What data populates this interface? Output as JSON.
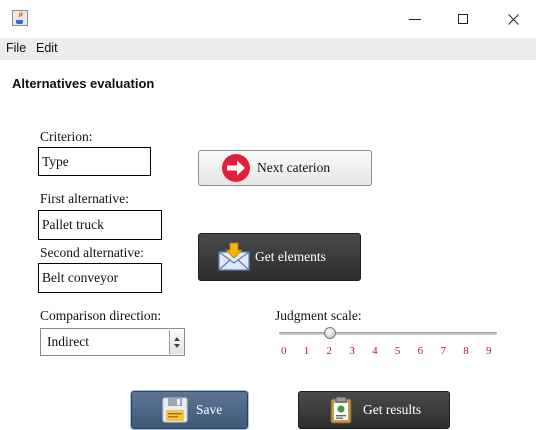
{
  "window": {
    "icon": "java-cup-icon"
  },
  "menubar": {
    "items": [
      "File",
      "Edit"
    ]
  },
  "heading": "Alternatives evaluation",
  "criterion": {
    "label": "Criterion:",
    "value": "Type"
  },
  "first_alternative": {
    "label": "First alternative:",
    "value": "Pallet truck"
  },
  "second_alternative": {
    "label": "Second alternative:",
    "value": "Belt conveyor"
  },
  "buttons": {
    "next_criterion": {
      "label": "Next caterion",
      "icon": "red-arrow-icon"
    },
    "get_elements": {
      "label": "Get elements",
      "icon": "envelope-download-icon"
    },
    "save": {
      "label": "Save",
      "icon": "floppy-disk-icon"
    },
    "get_results": {
      "label": "Get results",
      "icon": "clipboard-icon"
    }
  },
  "comparison_direction": {
    "label": "Comparison direction:",
    "selected": "Indirect"
  },
  "judgment_scale": {
    "label": "Judgment scale:",
    "ticks": [
      "0",
      "1",
      "2",
      "3",
      "4",
      "5",
      "6",
      "7",
      "8",
      "9"
    ],
    "min": 0,
    "max": 9,
    "value": 2
  },
  "colors": {
    "tick_label": "#b02020",
    "menubar_bg": "#ececec"
  }
}
